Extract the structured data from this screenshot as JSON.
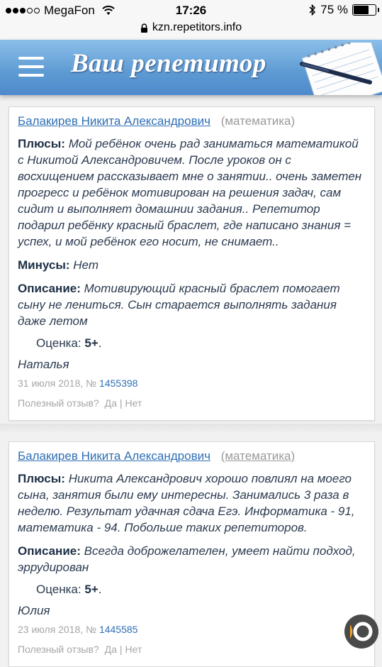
{
  "status": {
    "carrier": "MegaFon",
    "time": "17:26",
    "battery": "75 %",
    "battery_level": 0.75
  },
  "browser": {
    "url": "kzn.repetitors.info"
  },
  "header": {
    "logo": "Ваш репетитор",
    "menu_icon": "hamburger-icon",
    "decor_icon": "notebook-pen-icon"
  },
  "reviews": [
    {
      "tutor": "Балакирев Никита Александрович",
      "subject": "(математика)",
      "pros_label": "Плюсы:",
      "pros": "Мой ребёнок очень рад заниматься математикой с Никитой Александровичем. После уроков он с восхищением рассказывает мне о занятии.. очень заметен прогресс и ребёнок мотивирован на решения задач, сам сидит и выполняет домашнии задания.. Репетитор подарил ребёнку красный браслет, где написано знания = успех, и мой ребёнок его носит, не снимает..",
      "cons_label": "Минусы:",
      "cons": "Нет",
      "desc_label": "Описание:",
      "desc": "Мотивирующий красный браслет помогает сыну не лениться. Сын старается выполнять задания даже летом",
      "rating_label": "Оценка:",
      "rating": "5+",
      "rating_end": ".",
      "author": "Наталья",
      "date": "31 июля 2018, №",
      "number": "1455398",
      "useful_label": "Полезный отзыв?",
      "yes": "Да",
      "sep": "|",
      "no": "Нет"
    },
    {
      "tutor": "Балакирев Никита Александрович",
      "subject": "(математика)",
      "pros_label": "Плюсы:",
      "pros": "Никита Александрович хорошо повлиял на моего сына, занятия были ему интересны. Занимались 3 раза в неделю. Результат удачная сдача Егэ. Информатика - 91, математика - 94. Побольше таких репетиторов.",
      "desc_label": "Описание:",
      "desc": "Всегда доброжелателен, умеет найти подход, эррудирован",
      "rating_label": "Оценка:",
      "rating": "5+",
      "rating_end": ".",
      "author": "Юлия",
      "date": "23 июля 2018, №",
      "number": "1445585",
      "useful_label": "Полезный отзыв?",
      "yes": "Да",
      "sep": "|",
      "no": "Нет"
    }
  ]
}
